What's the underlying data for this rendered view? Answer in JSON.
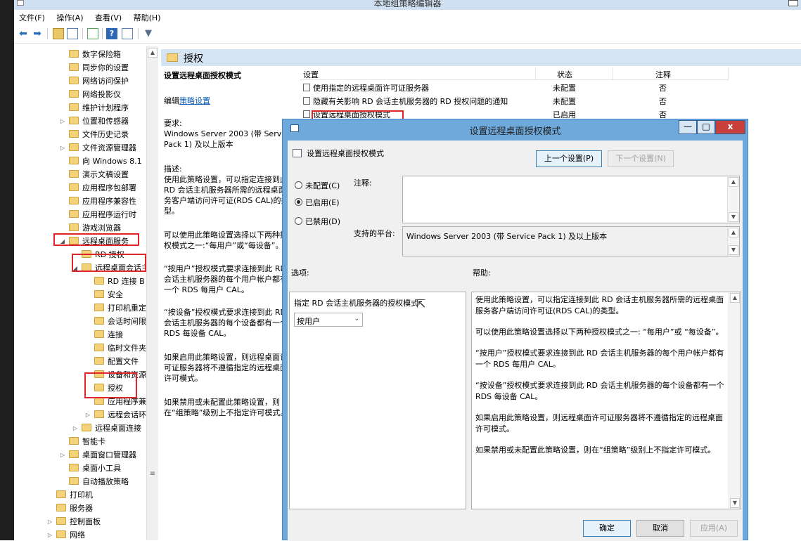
{
  "window": {
    "title": "本地组策略编辑器"
  },
  "menu": [
    "文件(F)",
    "操作(A)",
    "查看(V)",
    "帮助(H)"
  ],
  "tree": [
    {
      "label": "数字保险箱"
    },
    {
      "label": "同步你的设置"
    },
    {
      "label": "网络访问保护"
    },
    {
      "label": "网络投影仪"
    },
    {
      "label": "维护计划程序"
    },
    {
      "label": "位置和传感器"
    },
    {
      "label": "文件历史记录"
    },
    {
      "label": "文件资源管理器"
    },
    {
      "label": "向 Windows 8.1"
    },
    {
      "label": "演示文稿设置"
    },
    {
      "label": "应用程序包部署"
    },
    {
      "label": "应用程序兼容性"
    },
    {
      "label": "应用程序运行时"
    },
    {
      "label": "游戏浏览器"
    },
    {
      "label": "远程桌面服务"
    },
    {
      "label": "RD 授权"
    },
    {
      "label": "远程桌面会话主"
    },
    {
      "label": "RD 连接 B"
    },
    {
      "label": "安全"
    },
    {
      "label": "打印机重定"
    },
    {
      "label": "会话时间限"
    },
    {
      "label": "连接"
    },
    {
      "label": "临时文件夹"
    },
    {
      "label": "配置文件"
    },
    {
      "label": "设备和资源"
    },
    {
      "label": "授权"
    },
    {
      "label": "应用程序兼"
    },
    {
      "label": "远程会话环"
    },
    {
      "label": "远程桌面连接"
    },
    {
      "label": "智能卡"
    },
    {
      "label": "桌面窗口管理器"
    },
    {
      "label": "桌面小工具"
    },
    {
      "label": "自动播放策略"
    },
    {
      "label": "打印机"
    },
    {
      "label": "服务器"
    },
    {
      "label": "控制面板"
    },
    {
      "label": "网络"
    }
  ],
  "header": {
    "title": "授权"
  },
  "desc": {
    "title": "设置远程桌面授权模式",
    "edit_prefix": "编辑",
    "edit_link": "策略设置",
    "req_label": "要求:",
    "req_text": "Windows Server 2003 (带 Service Pack 1) 及以上版本",
    "desc_label": "描述:",
    "p1": "使用此策略设置，可以指定连接到此 RD 会话主机服务器所需的远程桌面服务客户端访问许可证(RDS CAL)的类型。",
    "p2": "可以使用此策略设置选择以下两种授权模式之一:“每用户”或“每设备”。",
    "p3": "“按用户”授权模式要求连接到此 RD 会话主机服务器的每个用户帐户都有一个 RDS 每用户 CAL。",
    "p4": "“按设备”授权模式要求连接到此 RD 会话主机服务器的每个设备都有一个 RDS 每设备 CAL。",
    "p5": "如果启用此策略设置，则远程桌面许可证服务器将不遵循指定的远程桌面许可模式。",
    "p6": "如果禁用或未配置此策略设置，则在“组策略”级别上不指定许可模式。"
  },
  "list": {
    "columns": [
      "设置",
      "状态",
      "注释"
    ],
    "rows": [
      {
        "name": "使用指定的远程桌面许可证服务器",
        "state": "未配置",
        "note": "否"
      },
      {
        "name": "隐藏有关影响 RD 会话主机服务器的 RD 授权问题的通知",
        "state": "未配置",
        "note": "否"
      },
      {
        "name": "设置远程桌面授权模式",
        "state": "已启用",
        "note": "否"
      }
    ]
  },
  "dialog": {
    "title": "设置远程桌面授权模式",
    "setting_name": "设置远程桌面授权模式",
    "prev_button": "上一个设置(P)",
    "next_button": "下一个设置(N)",
    "radio_not_configured": "未配置(C)",
    "radio_enabled": "已启用(E)",
    "radio_disabled": "已禁用(D)",
    "comment_label": "注释:",
    "platform_label": "支持的平台:",
    "platform_text": "Windows Server 2003 (带 Service Pack 1) 及以上版本",
    "options_label": "选项:",
    "help_label": "帮助:",
    "option_caption": "指定 RD 会话主机服务器的授权模式",
    "option_value": "按用户",
    "help": [
      "使用此策略设置，可以指定连接到此 RD 会话主机服务器所需的远程桌面服务客户端访问许可证(RDS CAL)的类型。",
      "可以使用此策略设置选择以下两种授权模式之一: “每用户”或 “每设备”。",
      "“按用户”授权模式要求连接到此 RD 会话主机服务器的每个用户帐户都有一个 RDS 每用户 CAL。",
      "“按设备”授权模式要求连接到此 RD 会话主机服务器的每个设备都有一个 RDS 每设备 CAL。",
      "如果启用此策略设置，则远程桌面许可证服务器将不遵循指定的远程桌面许可模式。",
      "如果禁用或未配置此策略设置，则在“组策略”级别上不指定许可模式。"
    ],
    "ok_button": "确定",
    "cancel_button": "取消",
    "apply_button": "应用(A)",
    "minimize_glyph": "—",
    "maximize_glyph": "□",
    "close_glyph": "x"
  },
  "colors": {
    "accent": "#6fa9dc",
    "highlight_red": "#e0262a",
    "header_bg": "#d5e4f3",
    "close_red": "#c7403a"
  }
}
